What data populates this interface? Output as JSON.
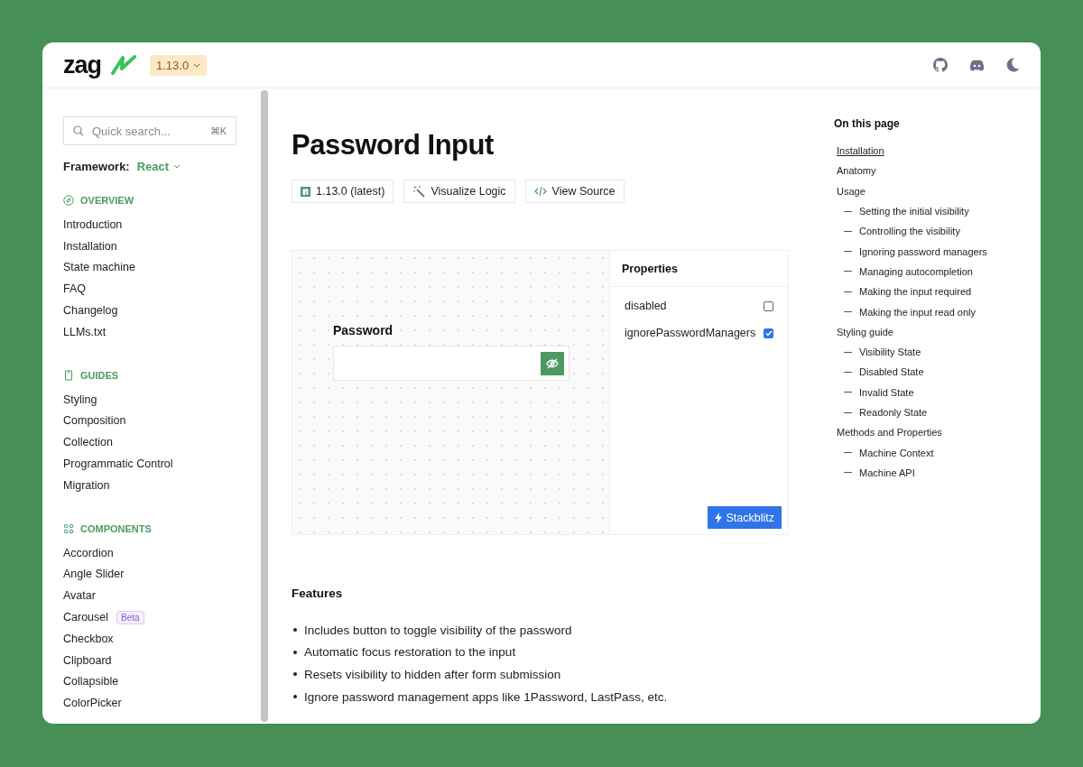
{
  "header": {
    "logo": "zag",
    "version": "1.13.0"
  },
  "sidebar": {
    "search": {
      "placeholder": "Quick search...",
      "shortcut": "⌘K"
    },
    "framework": {
      "label": "Framework:",
      "value": "React"
    },
    "sections": [
      {
        "kind": "overview",
        "title": "OVERVIEW",
        "items": [
          {
            "label": "Introduction"
          },
          {
            "label": "Installation"
          },
          {
            "label": "State machine"
          },
          {
            "label": "FAQ"
          },
          {
            "label": "Changelog"
          },
          {
            "label": "LLMs.txt"
          }
        ]
      },
      {
        "kind": "guides",
        "title": "GUIDES",
        "items": [
          {
            "label": "Styling"
          },
          {
            "label": "Composition"
          },
          {
            "label": "Collection"
          },
          {
            "label": "Programmatic Control"
          },
          {
            "label": "Migration"
          }
        ]
      },
      {
        "kind": "components",
        "title": "COMPONENTS",
        "items": [
          {
            "label": "Accordion"
          },
          {
            "label": "Angle Slider"
          },
          {
            "label": "Avatar"
          },
          {
            "label": "Carousel",
            "badge": "Beta"
          },
          {
            "label": "Checkbox"
          },
          {
            "label": "Clipboard"
          },
          {
            "label": "Collapsible"
          },
          {
            "label": "ColorPicker"
          }
        ]
      }
    ]
  },
  "page": {
    "title": "Password Input",
    "actions": [
      {
        "kind": "npm",
        "label": "1.13.0 (latest)"
      },
      {
        "kind": "visualize",
        "label": "Visualize Logic"
      },
      {
        "kind": "source",
        "label": "View Source"
      }
    ],
    "demo": {
      "field_label": "Password",
      "visible": false,
      "properties_title": "Properties",
      "properties": [
        {
          "name": "disabled",
          "checked": false
        },
        {
          "name": "ignorePasswordManagers",
          "checked": true
        }
      ],
      "stackblitz": "Stackblitz"
    },
    "features_title": "Features",
    "features": [
      "Includes button to toggle visibility of the password",
      "Automatic focus restoration to the input",
      "Resets visibility to hidden after form submission",
      "Ignore password management apps like 1Password, LastPass, etc."
    ]
  },
  "toc": {
    "title": "On this page",
    "items": [
      {
        "label": "Installation",
        "selected": true
      },
      {
        "label": "Anatomy",
        "selected": false
      },
      {
        "label": "Usage",
        "selected": false,
        "children": [
          {
            "label": "Setting the initial visibility",
            "selected": false
          },
          {
            "label": "Controlling the visibility",
            "selected": false
          },
          {
            "label": "Ignoring password managers",
            "selected": false
          },
          {
            "label": "Managing autocompletion",
            "selected": false
          },
          {
            "label": "Making the input required",
            "selected": false
          },
          {
            "label": "Making the input read only",
            "selected": false
          }
        ]
      },
      {
        "label": "Styling guide",
        "selected": false,
        "children": [
          {
            "label": "Visibility State",
            "selected": false
          },
          {
            "label": "Disabled State",
            "selected": false
          },
          {
            "label": "Invalid State",
            "selected": false
          },
          {
            "label": "Readonly State",
            "selected": false
          }
        ]
      },
      {
        "label": "Methods and Properties",
        "selected": false,
        "children": [
          {
            "label": "Machine Context",
            "selected": false
          },
          {
            "label": "Machine API",
            "selected": false
          }
        ]
      }
    ]
  }
}
